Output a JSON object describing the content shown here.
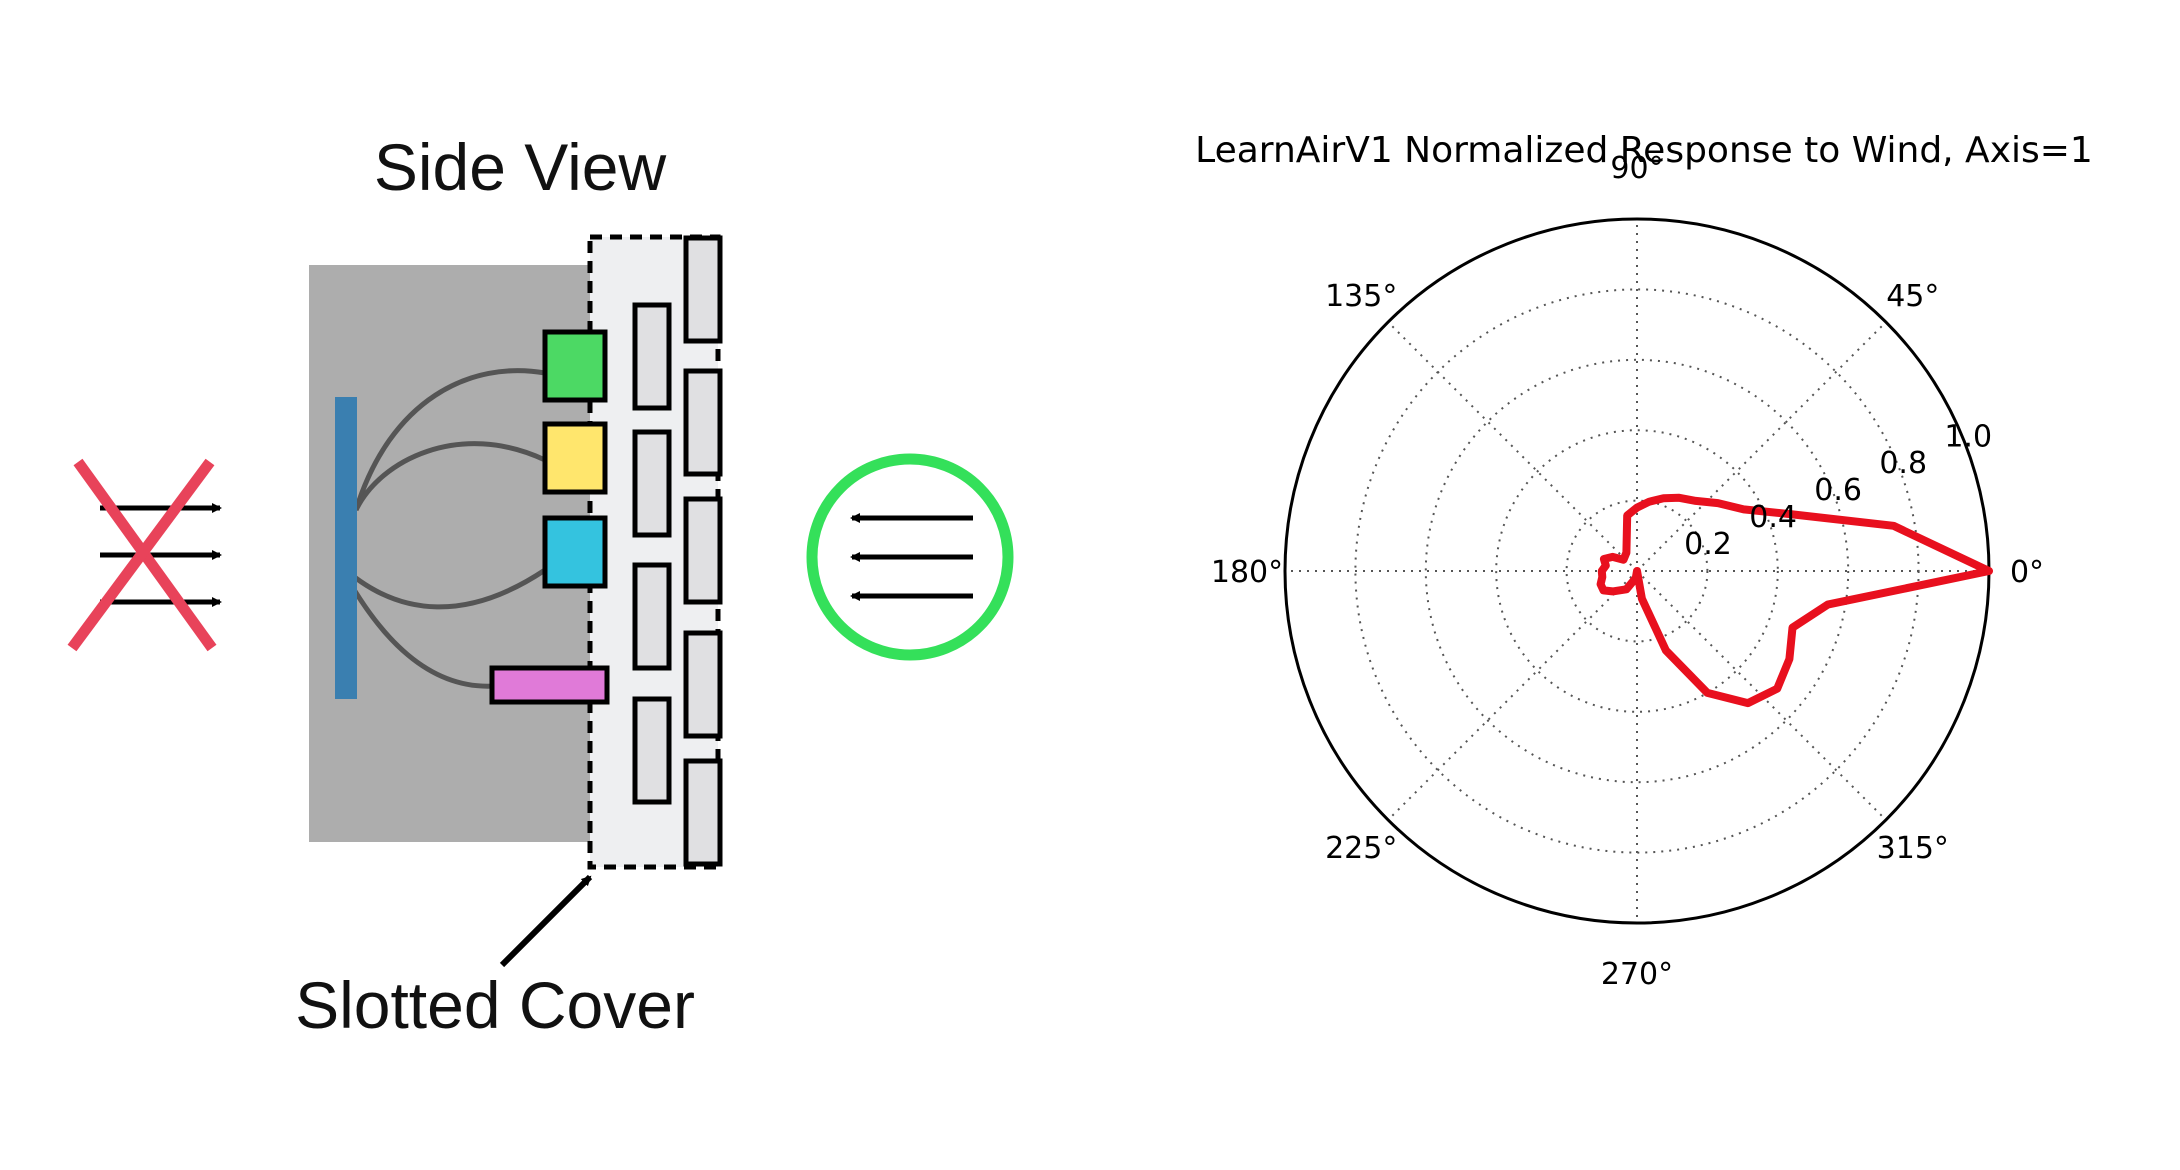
{
  "diagram": {
    "title": "Side View",
    "cover_label": "Slotted Cover",
    "sensor_colors": [
      "#4cd964",
      "#ffe66d",
      "#34c3df",
      "#e07ad8"
    ],
    "board_color": "#3a7fb0",
    "housing_color": "#adadad",
    "cover_color": "#eeeff1",
    "reject_mark_color": "#e8435a",
    "accept_ring_color": "#34e05a"
  },
  "chart_data": {
    "type": "polar-line",
    "title": "LearnAirV1 Normalized Response to Wind, Axis=1",
    "r_max": 1.0,
    "r_ticks": [
      "0.2",
      "0.4",
      "0.6",
      "0.8",
      "1.0"
    ],
    "angle_ticks": [
      "0°",
      "45°",
      "90°",
      "135°",
      "180°",
      "225°",
      "270°",
      "315°"
    ],
    "grid": true,
    "series": [
      {
        "color": "#e8101e",
        "theta_deg": [
          0,
          10,
          20,
          30,
          40,
          50,
          60,
          70,
          80,
          90,
          100,
          120,
          140,
          150,
          160,
          170,
          180,
          190,
          200,
          210,
          220,
          240,
          260,
          270,
          280,
          290,
          300,
          310,
          320,
          330,
          340,
          350,
          360
        ],
        "r": [
          1.0,
          0.74,
          0.47,
          0.35,
          0.3,
          0.26,
          0.24,
          0.22,
          0.2,
          0.18,
          0.16,
          0.06,
          0.05,
          0.08,
          0.1,
          0.09,
          0.1,
          0.1,
          0.11,
          0.11,
          0.09,
          0.06,
          0.02,
          0.0,
          0.08,
          0.24,
          0.4,
          0.49,
          0.52,
          0.5,
          0.47,
          0.55,
          1.0
        ]
      }
    ]
  }
}
